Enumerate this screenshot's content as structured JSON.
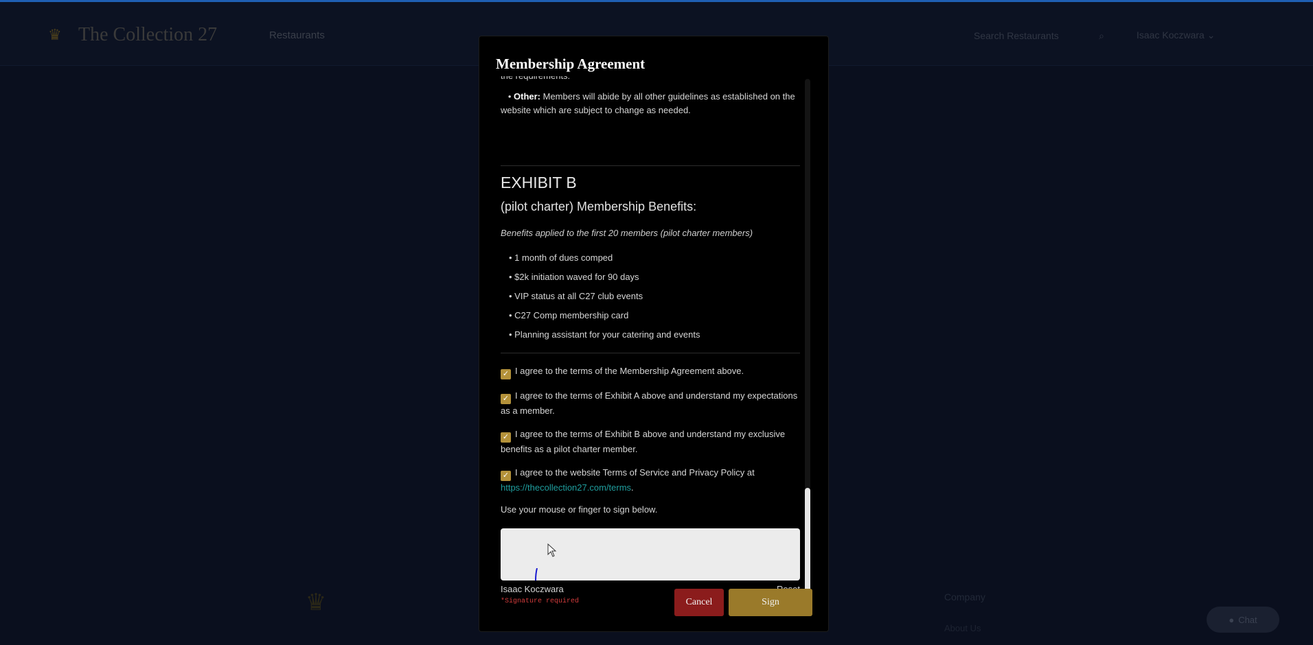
{
  "bg": {
    "logo_text": "The Collection 27",
    "nav_label": "Restaurants",
    "search_placeholder": "Search Restaurants",
    "user_label": "Isaac Koczwara",
    "footer_heading": "Company",
    "footer_link": "About Us",
    "chat_label": "Chat"
  },
  "modal": {
    "title": "Membership Agreement",
    "cut_text": "the requirements.",
    "other_label": "Other:",
    "other_text": " Members will abide by all other guidelines as established on the website which are subject to change as needed.",
    "exhibit_title": "EXHIBIT B",
    "exhibit_subtitle": "(pilot charter) Membership Benefits:",
    "exhibit_note": "Benefits applied to the first 20 members (pilot charter members)",
    "benefits": [
      "1 month of dues comped",
      "$2k initiation waved for 90 days",
      "VIP status at all C27 club events",
      "C27 Comp membership card",
      "Planning assistant for your catering and events"
    ],
    "agreements": [
      "I agree to the terms of the Membership Agreement above.",
      "I agree to the terms of Exhibit A above and understand my expectations as a member.",
      "I agree to the terms of Exhibit B above and understand my exclusive benefits as a pilot charter member.",
      "I agree to the website Terms of Service and Privacy Policy at "
    ],
    "terms_link": "https://thecollection27.com/terms",
    "terms_suffix": ".",
    "sign_instruction": "Use your mouse or finger to sign below.",
    "signer_name": "Isaac Koczwara",
    "reset_label": "Reset",
    "signature_error": "*Signature required",
    "cancel_label": "Cancel",
    "sign_label": "Sign"
  },
  "colors": {
    "checkbox": "#b4923a",
    "cancel": "#8b1c1c",
    "sign": "#9a7a2a",
    "link": "#1f9e9e",
    "error": "#d23c3c"
  }
}
